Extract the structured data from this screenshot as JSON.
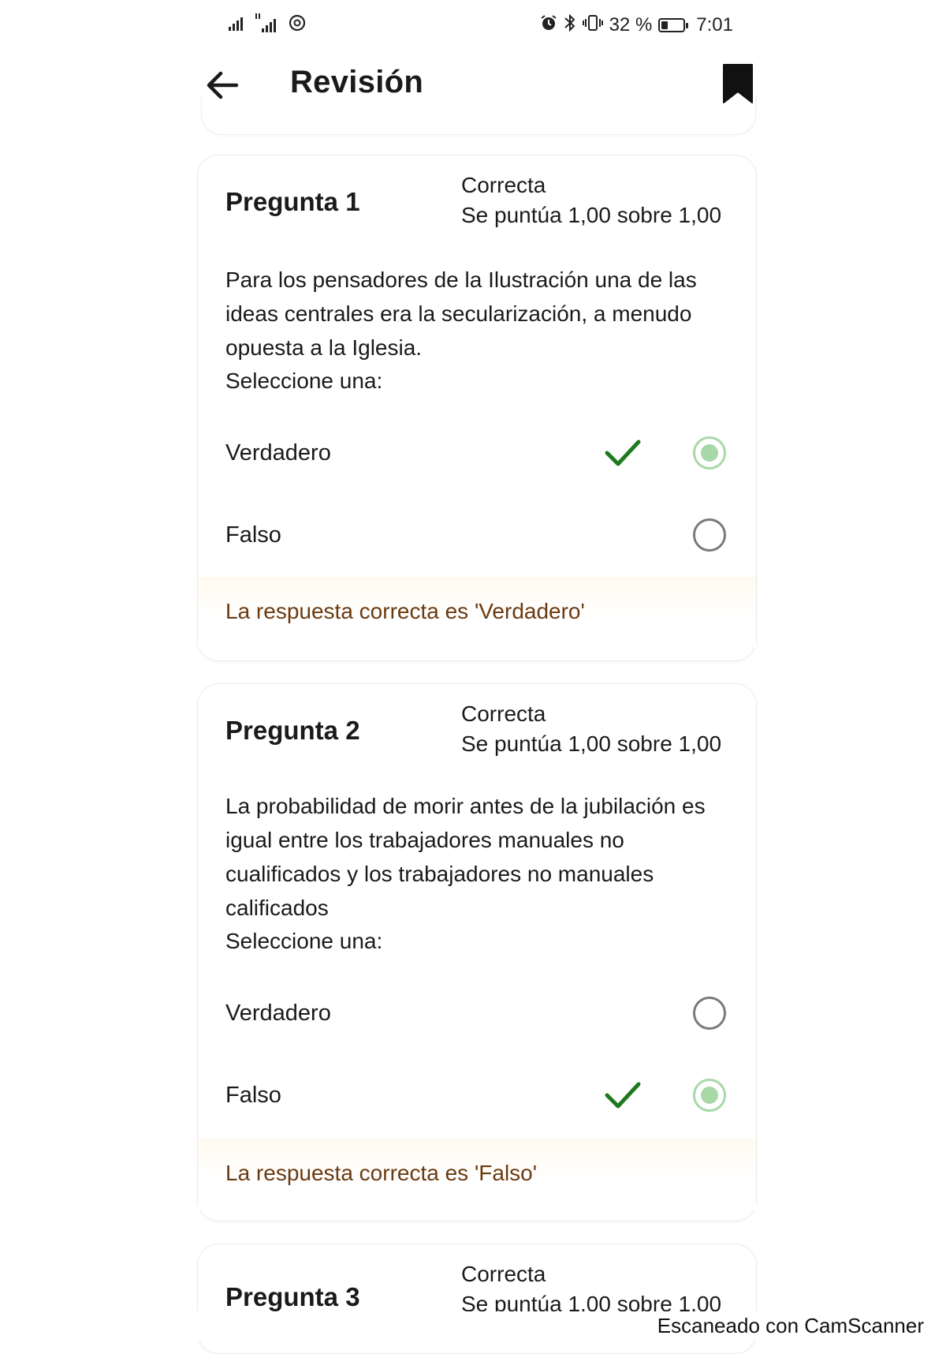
{
  "status_bar": {
    "signal_left": "signal-bars",
    "signal_right": "signal-bars",
    "app_icon": "threads-icon",
    "battery_percent": "32 %",
    "battery_level": 0.32,
    "time": "7:01"
  },
  "app_bar": {
    "title": "Revisión",
    "back_icon": "arrow-left-icon",
    "bookmark_icon": "bookmark-icon"
  },
  "questions": [
    {
      "name": "Pregunta 1",
      "state": "Correcta",
      "score": "Se puntúa 1,00 sobre 1,00",
      "text": "Para los pensadores de la Ilustración una de las ideas centrales era la secularización, a menudo opuesta a la Iglesia.",
      "prompt": "Seleccione una:",
      "options": [
        {
          "label": "Verdadero",
          "selected": true,
          "correct": true
        },
        {
          "label": "Falso",
          "selected": false,
          "correct": false
        }
      ],
      "feedback": "La respuesta correcta es 'Verdadero'"
    },
    {
      "name": "Pregunta 2",
      "state": "Correcta",
      "score": "Se puntúa 1,00 sobre 1,00",
      "text": "La probabilidad de morir antes de la jubilación es igual entre los trabajadores manuales no cualificados y los trabajadores no manuales calificados",
      "prompt": "Seleccione una:",
      "options": [
        {
          "label": "Verdadero",
          "selected": false,
          "correct": false
        },
        {
          "label": "Falso",
          "selected": true,
          "correct": true
        }
      ],
      "feedback": "La respuesta correcta es 'Falso'"
    },
    {
      "name": "Pregunta 3",
      "state": "Correcta",
      "score": "Se puntúa 1,00 sobre 1,00"
    }
  ],
  "footer": {
    "scanner_text": "Escaneado con CamScanner"
  },
  "colors": {
    "check_green": "#1e7a1e",
    "radio_selected": "#a8d8a8",
    "feedback_text": "#6b3a10"
  }
}
